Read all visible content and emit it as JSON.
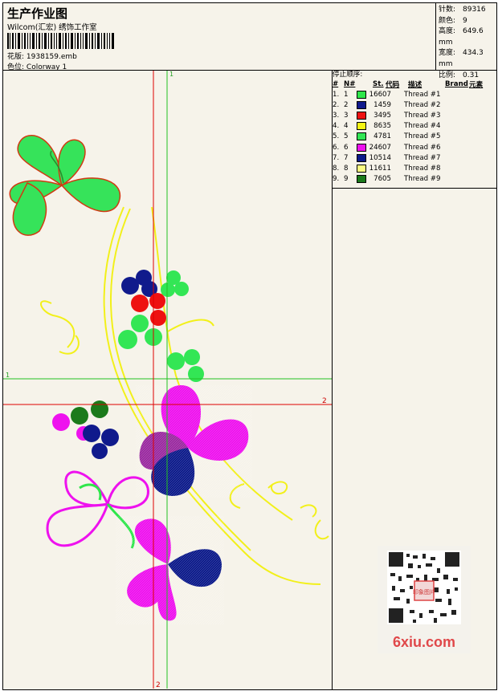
{
  "header": {
    "title": "生产作业图",
    "subtitle": "Wilcom(汇宏) 绣饰工作室",
    "design_label": "花版:",
    "design_file": "1938159.emb",
    "colorway_label": "色位:",
    "colorway": "Colorway 1"
  },
  "stats": {
    "stitches_label": "针数:",
    "stitches": "89316",
    "colors_label": "颜色:",
    "colors": "9",
    "height_label": "高度:",
    "height": "649.6 mm",
    "width_label": "宽度:",
    "width": "434.3 mm",
    "scale_label": "比例:",
    "scale": "0.31"
  },
  "threads": {
    "heading": "停止顺序:",
    "columns": {
      "num": "#",
      "n": "N#",
      "st": "St.",
      "code": "代码",
      "desc": "描述",
      "brand": "Brand",
      "element": "元素"
    },
    "rows": [
      {
        "num": "1.",
        "n": "1",
        "color": "#2ee64a",
        "st": "16607",
        "desc": "Thread #1"
      },
      {
        "num": "2.",
        "n": "2",
        "color": "#101a8c",
        "st": "1459",
        "desc": "Thread #2"
      },
      {
        "num": "3.",
        "n": "3",
        "color": "#ee1111",
        "st": "3495",
        "desc": "Thread #3"
      },
      {
        "num": "4.",
        "n": "4",
        "color": "#f4f413",
        "st": "8635",
        "desc": "Thread #4"
      },
      {
        "num": "5.",
        "n": "5",
        "color": "#33e655",
        "st": "4781",
        "desc": "Thread #5"
      },
      {
        "num": "6.",
        "n": "6",
        "color": "#ee11ee",
        "st": "24607",
        "desc": "Thread #6"
      },
      {
        "num": "7.",
        "n": "7",
        "color": "#0c1a8a",
        "st": "10514",
        "desc": "Thread #7"
      },
      {
        "num": "8.",
        "n": "8",
        "color": "#fafa80",
        "st": "11611",
        "desc": "Thread #8"
      },
      {
        "num": "9.",
        "n": "9",
        "color": "#1b7a1b",
        "st": "7605",
        "desc": "Thread #9"
      }
    ]
  },
  "guides": {
    "label_1": "1",
    "label_2": "2"
  },
  "watermark": {
    "text": "6xiu.com",
    "stamp": "印象图片"
  }
}
